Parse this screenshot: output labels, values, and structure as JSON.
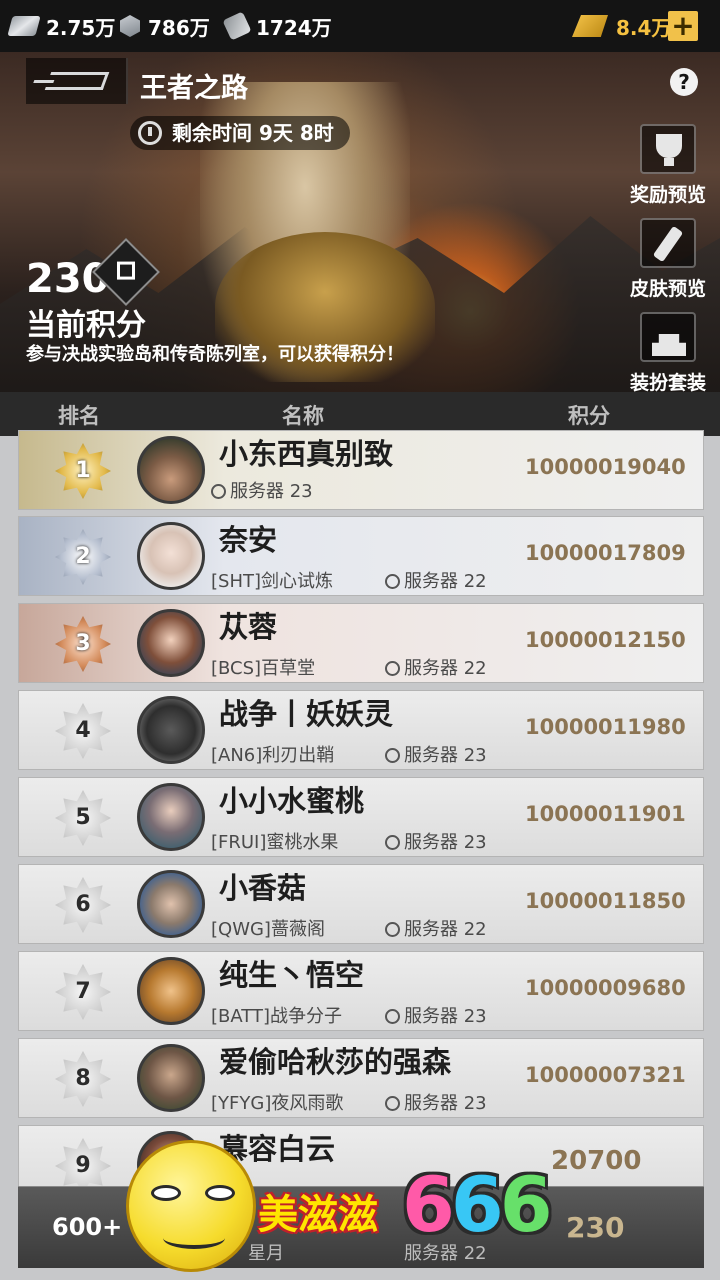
{
  "currencies": {
    "cash": "2.75万",
    "cube": "786万",
    "coupon": "1724万",
    "gold": "8.4万",
    "add_label": "+"
  },
  "header": {
    "title": "王者之路",
    "help": "?",
    "timer": "剩余时间 9天 8时"
  },
  "score_panel": {
    "score": "230",
    "label": "当前积分",
    "hint": "参与决战实验岛和传奇陈列室，可以获得积分！"
  },
  "side_buttons": [
    {
      "label": "奖励预览",
      "icon": "trophy-icon"
    },
    {
      "label": "皮肤预览",
      "icon": "brush-icon"
    },
    {
      "label": "装扮套装",
      "icon": "stand-icon"
    }
  ],
  "columns": {
    "rank": "排名",
    "name": "名称",
    "score": "积分"
  },
  "rows": [
    {
      "rank": "1",
      "name": "小东西真别致",
      "clan": "",
      "server": "服务器 23",
      "score": "10000019040"
    },
    {
      "rank": "2",
      "name": "奈安",
      "clan": "[SHT]剑心试炼",
      "server": "服务器 22",
      "score": "10000017809"
    },
    {
      "rank": "3",
      "name": "苁蓉",
      "clan": "[BCS]百草堂",
      "server": "服务器 22",
      "score": "10000012150"
    },
    {
      "rank": "4",
      "name": "战争丨妖妖灵",
      "clan": "[AN6]利刃出鞘",
      "server": "服务器 23",
      "score": "10000011980"
    },
    {
      "rank": "5",
      "name": "小小水蜜桃",
      "clan": "[FRUI]蜜桃水果",
      "server": "服务器 23",
      "score": "10000011901"
    },
    {
      "rank": "6",
      "name": "小香菇",
      "clan": "[QWG]蔷薇阁",
      "server": "服务器 22",
      "score": "10000011850"
    },
    {
      "rank": "7",
      "name": "纯生丶悟空",
      "clan": "[BATT]战争分子",
      "server": "服务器 23",
      "score": "10000009680"
    },
    {
      "rank": "8",
      "name": "爱偷哈秋莎的强森",
      "clan": "[YFYG]夜风雨歌",
      "server": "服务器 23",
      "score": "10000007321"
    },
    {
      "rank": "9",
      "name": "慕容白云",
      "clan": "",
      "server": "",
      "score": "20700"
    }
  ],
  "my_rank": {
    "rank": "600+",
    "name_partial": "星月",
    "server_partial": "服务器 22",
    "score": "230"
  },
  "sticker": {
    "text": "美滋滋",
    "n1": "6",
    "n2": "6",
    "n3": "6"
  }
}
